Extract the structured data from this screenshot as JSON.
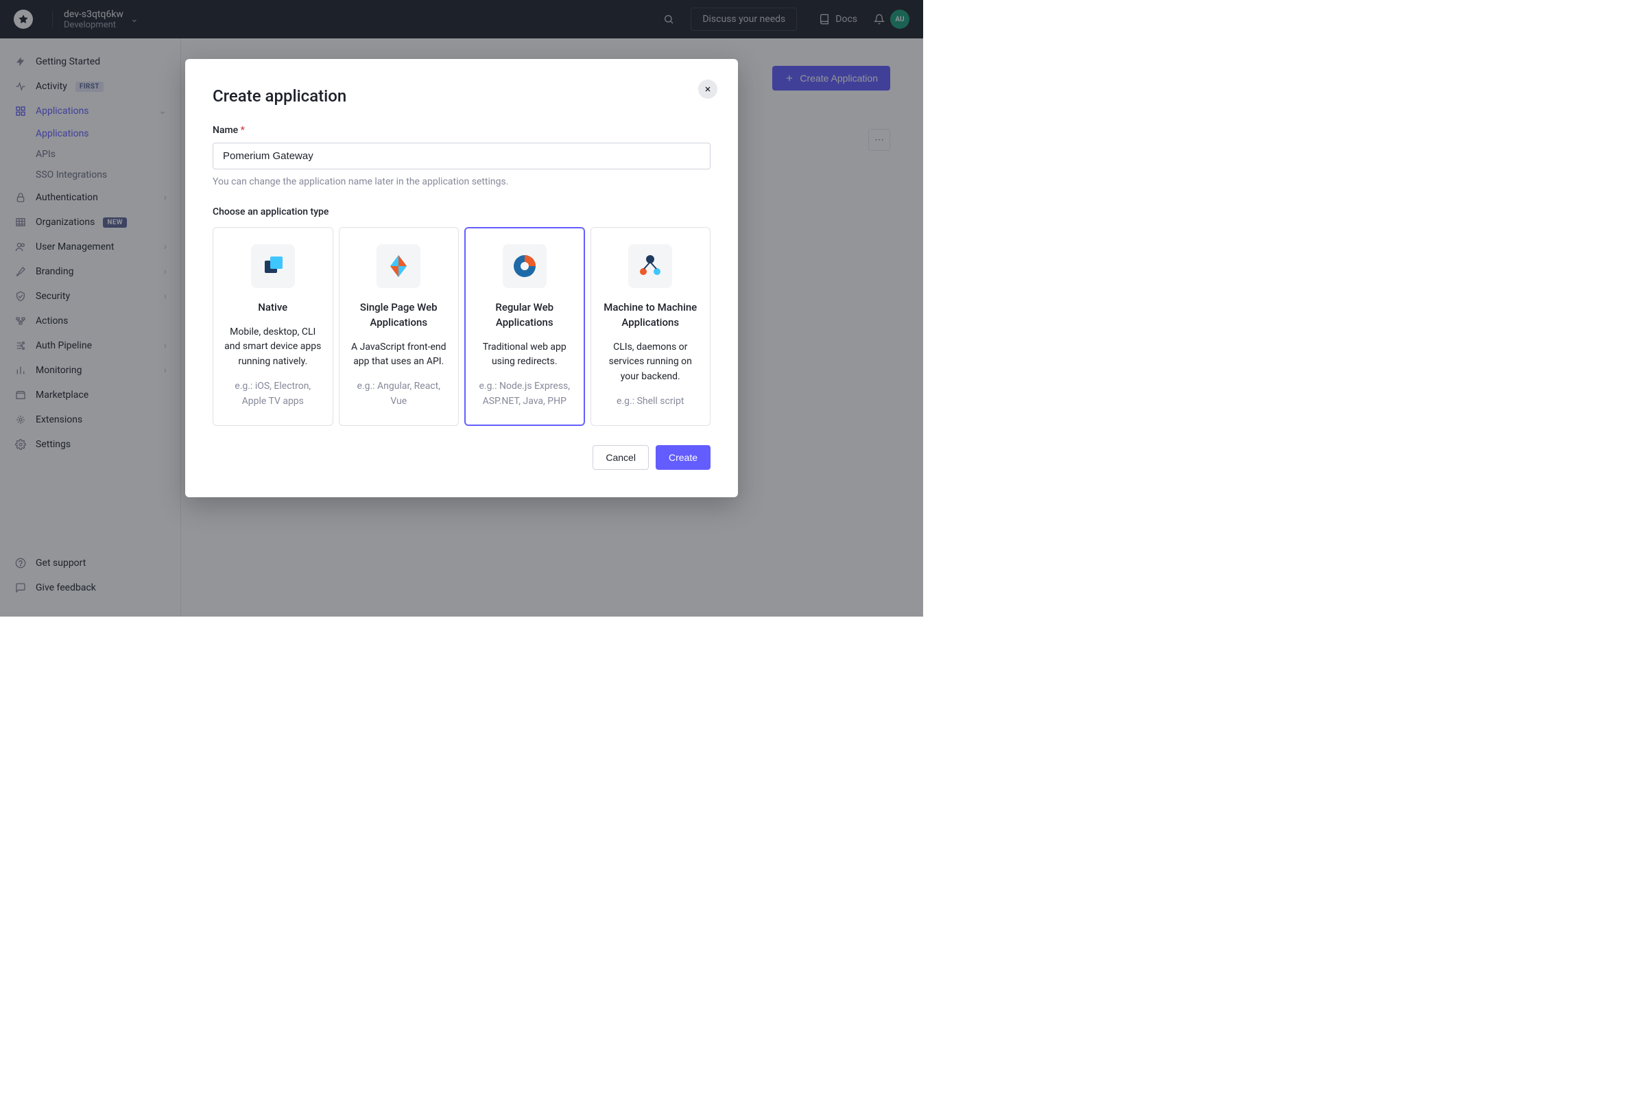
{
  "header": {
    "tenant_name": "dev-s3qtq6kw",
    "tenant_env": "Development",
    "discuss": "Discuss your needs",
    "docs": "Docs",
    "avatar_initials": "AU"
  },
  "sidebar": {
    "items": [
      {
        "label": "Getting Started",
        "icon": "bolt"
      },
      {
        "label": "Activity",
        "icon": "pulse",
        "badge": "FIRST",
        "badge_kind": "first"
      },
      {
        "label": "Applications",
        "icon": "apps",
        "active": true,
        "chev": true,
        "expanded": true,
        "sub": [
          {
            "label": "Applications",
            "active": true
          },
          {
            "label": "APIs"
          },
          {
            "label": "SSO Integrations"
          }
        ]
      },
      {
        "label": "Authentication",
        "icon": "lock",
        "chev": true
      },
      {
        "label": "Organizations",
        "icon": "org",
        "badge": "NEW",
        "badge_kind": "new"
      },
      {
        "label": "User Management",
        "icon": "users",
        "chev": true
      },
      {
        "label": "Branding",
        "icon": "brush",
        "chev": true
      },
      {
        "label": "Security",
        "icon": "shield",
        "chev": true
      },
      {
        "label": "Actions",
        "icon": "flow"
      },
      {
        "label": "Auth Pipeline",
        "icon": "pipeline",
        "chev": true
      },
      {
        "label": "Monitoring",
        "icon": "bars",
        "chev": true
      },
      {
        "label": "Marketplace",
        "icon": "market"
      },
      {
        "label": "Extensions",
        "icon": "ext"
      },
      {
        "label": "Settings",
        "icon": "gear"
      }
    ],
    "footer": [
      {
        "label": "Get support",
        "icon": "help"
      },
      {
        "label": "Give feedback",
        "icon": "comment"
      }
    ]
  },
  "page": {
    "create_button": "Create Application"
  },
  "modal": {
    "title": "Create application",
    "name_label": "Name",
    "name_value": "Pomerium Gateway",
    "name_hint": "You can change the application name later in the application settings.",
    "type_label": "Choose an application type",
    "types": [
      {
        "title": "Native",
        "desc": "Mobile, desktop, CLI and smart device apps running natively.",
        "ex": "e.g.: iOS, Electron, Apple TV apps"
      },
      {
        "title": "Single Page Web Applications",
        "desc": "A JavaScript front-end app that uses an API.",
        "ex": "e.g.: Angular, React, Vue"
      },
      {
        "title": "Regular Web Applications",
        "desc": "Traditional web app using redirects.",
        "ex": "e.g.: Node.js Express, ASP.NET, Java, PHP",
        "selected": true
      },
      {
        "title": "Machine to Machine Applications",
        "desc": "CLIs, daemons or services running on your backend.",
        "ex": "e.g.: Shell script"
      }
    ],
    "cancel": "Cancel",
    "create": "Create"
  }
}
